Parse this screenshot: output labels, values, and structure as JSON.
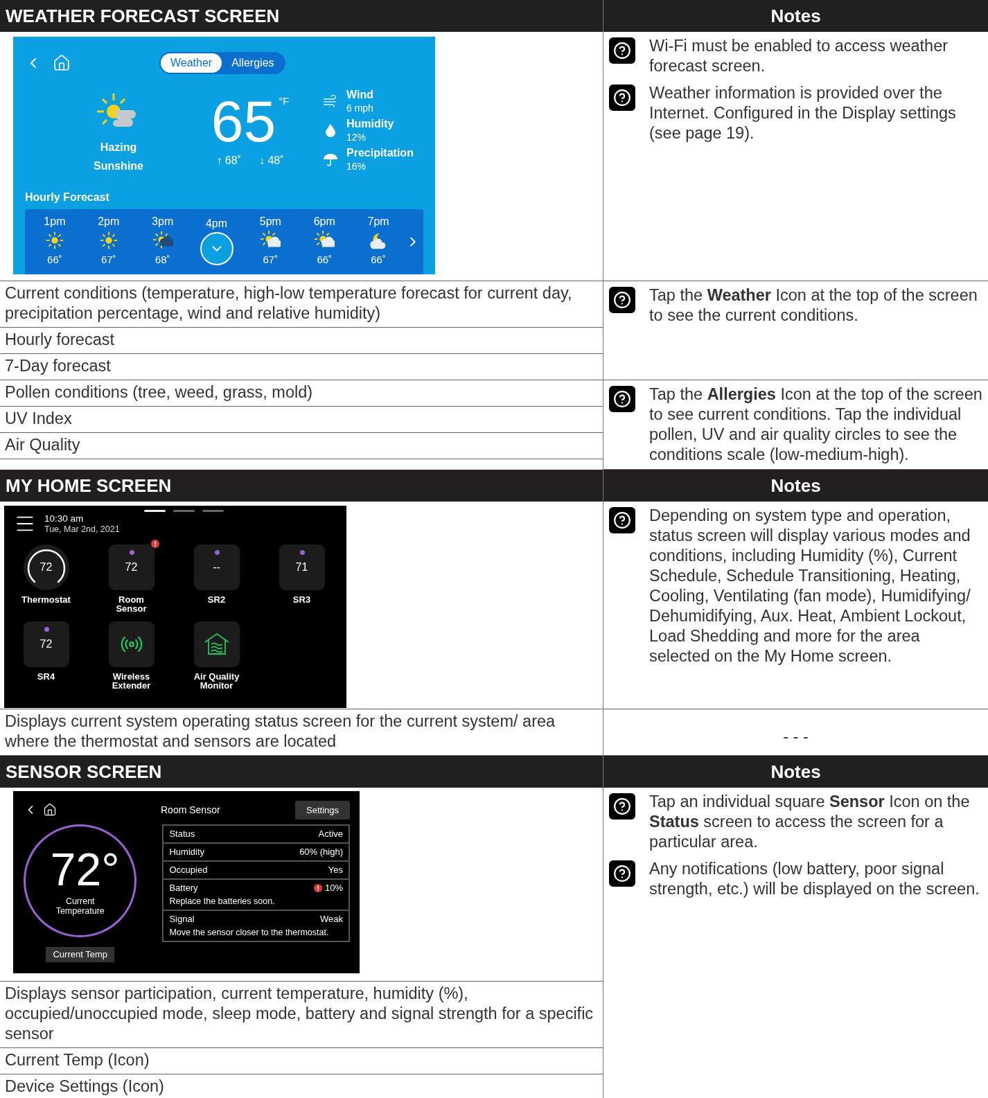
{
  "sections": [
    {
      "title": "WEATHER FORECAST SCREEN",
      "notes_title": "Notes",
      "screen": {
        "kind": "weather",
        "tabs": [
          {
            "label": "Weather",
            "selected": true
          },
          {
            "label": "Allergies",
            "selected": false
          }
        ],
        "condition": "Hazing Sunshine",
        "temperature": "65",
        "unit": "°F",
        "high": "↑ 68˚",
        "low": "↓ 48˚",
        "stats": [
          {
            "kind": "wind",
            "label": "Wind",
            "value": "6 mph"
          },
          {
            "kind": "humidity",
            "label": "Humidity",
            "value": "12%"
          },
          {
            "kind": "precipitation",
            "label": "Precipitation",
            "value": "16%"
          }
        ],
        "hourly_title": "Hourly Forecast",
        "hourly": [
          {
            "time": "1pm",
            "kind": "sun",
            "temp": "66˚",
            "selected": false
          },
          {
            "time": "2pm",
            "kind": "sun",
            "temp": "67˚",
            "selected": false
          },
          {
            "time": "3pm",
            "kind": "haze",
            "temp": "68˚",
            "selected": false
          },
          {
            "time": "4pm",
            "selected": true
          },
          {
            "time": "5pm",
            "kind": "sun-cloud",
            "temp": "67˚",
            "selected": false
          },
          {
            "time": "6pm",
            "kind": "sun-cloud",
            "temp": "66˚",
            "selected": false
          },
          {
            "time": "7pm",
            "kind": "moon-cloud",
            "temp": "66˚",
            "selected": false
          }
        ]
      },
      "screen_notes": [
        {
          "kind": "tip",
          "text": "Wi-Fi must be enabled to access weather forecast screen."
        },
        {
          "kind": "tip",
          "text": "Weather information is provided over the Internet. Configured in the Display settings (see page 19)."
        }
      ],
      "groups": [
        {
          "rows": [
            "Current conditions (temperature, high-low temperature forecast for current day, precipitation percentage, wind and relative humidity)",
            "Hourly forecast",
            "7-Day forecast"
          ],
          "notes": [
            {
              "kind": "tip",
              "text": "Tap the **Weather** Icon at the top of the screen to see the current conditions."
            }
          ]
        },
        {
          "rows": [
            "Pollen conditions (tree, weed, grass, mold)",
            "UV Index",
            "Air Quality"
          ],
          "notes": [
            {
              "kind": "tip",
              "text": "Tap the **Allergies** Icon at the top of the screen to see current conditions. Tap the individual pollen, UV and air quality circles to see the conditions scale (low-medium-high)."
            }
          ]
        }
      ]
    },
    {
      "title": "MY HOME SCREEN",
      "notes_title": "Notes",
      "screen": {
        "kind": "home",
        "pages": [
          {
            "selected": true
          },
          {
            "selected": false
          },
          {
            "selected": false
          }
        ],
        "time": "10:30 am",
        "date": "Tue, Mar 2nd, 2021",
        "tiles": [
          {
            "kind": "dial",
            "value": "72",
            "label": "Thermostat",
            "alert": false
          },
          {
            "kind": "sensor",
            "value": "72",
            "label": "Room Sensor",
            "alert": true
          },
          {
            "kind": "sensor",
            "value": "--",
            "label": "SR2",
            "alert": false
          },
          {
            "kind": "sensor",
            "value": "71",
            "label": "SR3",
            "alert": false
          },
          {
            "kind": "sensor",
            "value": "72",
            "label": "SR4",
            "alert": false
          },
          {
            "kind": "wireless",
            "label": "Wireless Extender",
            "alert": false
          },
          {
            "kind": "air",
            "label": "Air Quality Monitor",
            "alert": false
          }
        ]
      },
      "screen_notes": [
        {
          "kind": "tip",
          "text": "Depending on system type and operation, status screen will display various modes and conditions, including Humidity (%), Current Schedule, Schedule Transitioning, Heating, Cooling, Ventilating (fan mode), Humidifying/ Dehumidifying, Aux. Heat, Ambient Lockout, Load Shedding and more for the area selected on the My Home screen."
        }
      ],
      "groups": [
        {
          "rows": [
            "Displays current system operating status screen for the current system/ area where the thermostat and sensors are located"
          ],
          "notes": [
            {
              "kind": "dash",
              "text": "- - -"
            }
          ]
        }
      ]
    },
    {
      "title": "SENSOR SCREEN",
      "notes_title": "Notes",
      "screen": {
        "kind": "sensor",
        "title": "Room Sensor",
        "settings": "Settings",
        "temperature": "72°",
        "caption": "Current Temperature",
        "tab": "Current Temp",
        "rows": [
          {
            "label": "Status",
            "value": "Active",
            "alert": false
          },
          {
            "label": "Humidity",
            "value": "60% (high)",
            "alert": false
          },
          {
            "label": "Occupied",
            "value": "Yes",
            "alert": false
          },
          {
            "label": "Battery",
            "value": "10%",
            "message": "Replace the batteries soon.",
            "alert": true
          },
          {
            "label": "Signal",
            "value": "Weak",
            "message": "Move the sensor closer to the thermostat.",
            "alert": false
          }
        ]
      },
      "screen_notes": [
        {
          "kind": "tip",
          "text": "Tap an individual square **Sensor** Icon on the **Status** screen to access the screen for a particular area."
        },
        {
          "kind": "tip",
          "text": "Any notifications (low battery, poor signal strength, etc.) will be displayed on the screen."
        }
      ],
      "groups": [
        {
          "rows": [
            "Displays sensor participation, current temperature, humidity (%), occupied/unoccupied mode, sleep mode, battery and signal strength for a specific sensor",
            "Current Temp (Icon)",
            "Device Settings (Icon)"
          ]
        }
      ]
    }
  ]
}
